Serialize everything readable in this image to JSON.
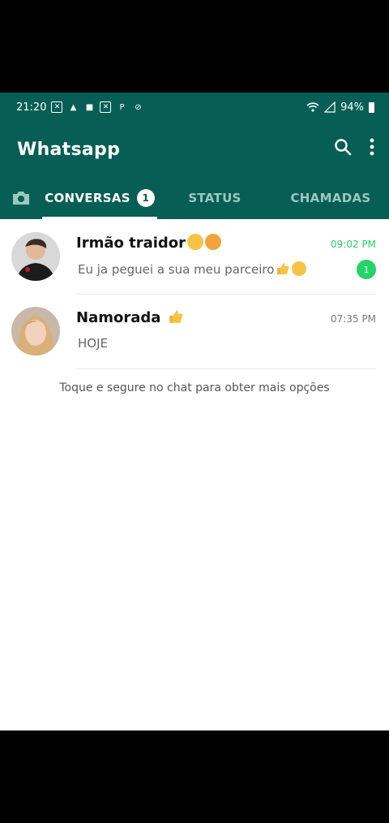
{
  "status_bar": {
    "time": "21:20",
    "battery": "94%"
  },
  "app": {
    "title": "Whatsapp",
    "colors": {
      "primary": "#075e54",
      "accent": "#25d366"
    }
  },
  "tabs": [
    {
      "label": "CONVERSAS",
      "badge": "1",
      "active": true
    },
    {
      "label": "STATUS",
      "active": false
    },
    {
      "label": "CHAMADAS",
      "active": false
    }
  ],
  "chats": [
    {
      "name": "Irmão traidor",
      "time": "09:02 PM",
      "message": "Eu ja peguei a sua meu parceiro",
      "unread": "1"
    },
    {
      "name": "Namorada",
      "time": "07:35 PM",
      "message": "HOJE"
    }
  ],
  "hint": "Toque e segure no chat para obter mais opções"
}
